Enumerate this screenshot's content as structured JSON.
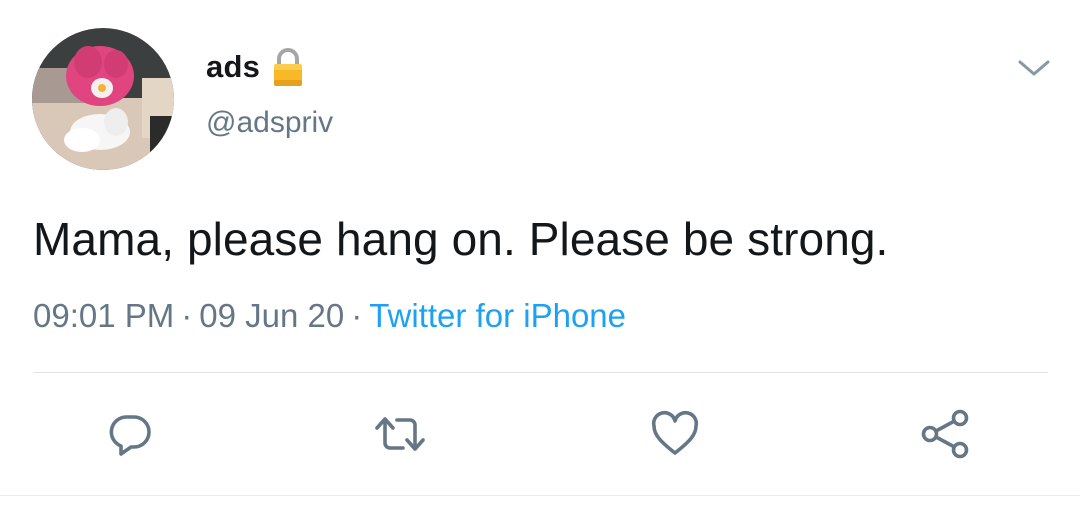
{
  "user": {
    "display_name": "ads",
    "handle": "@adspriv"
  },
  "tweet": {
    "text": "Mama, please hang on. Please be strong.",
    "time": "09:01 PM",
    "separator": "·",
    "date": "09 Jun 20",
    "source": "Twitter for iPhone"
  },
  "icons": {
    "lock": "lock-icon",
    "caret": "chevron-down-icon",
    "reply": "reply-icon",
    "retweet": "retweet-icon",
    "like": "heart-icon",
    "share": "share-icon"
  },
  "colors": {
    "text_primary": "#14171a",
    "text_secondary": "#657786",
    "link": "#1da1f2",
    "icon": "#657786"
  }
}
